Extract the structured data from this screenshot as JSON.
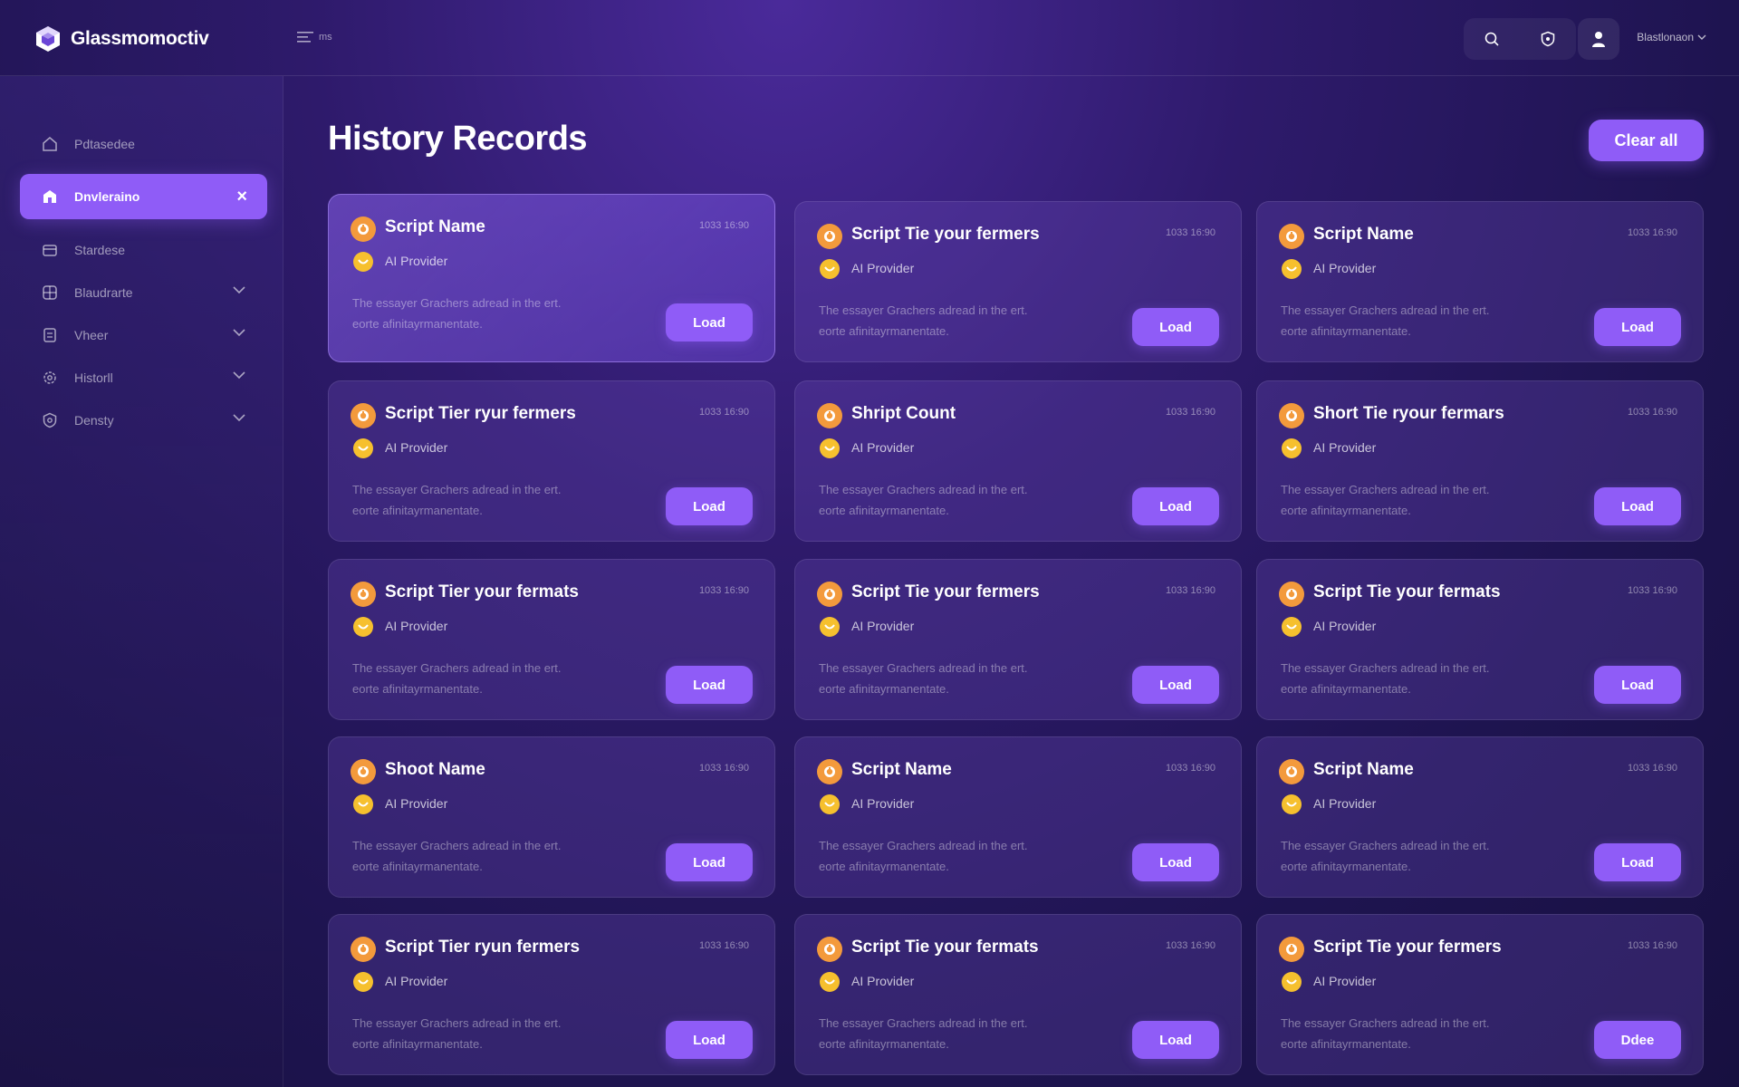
{
  "app": {
    "brand": "Glassmomoctiv"
  },
  "header": {
    "menu_label": "ms",
    "user_name": "Blastlonaon"
  },
  "sidebar": {
    "items": [
      {
        "label": "Pdtasedee",
        "icon": "home-icon",
        "active": false
      },
      {
        "label": "Dnvleraino",
        "icon": "building-icon",
        "active": true
      },
      {
        "label": "Stardese",
        "icon": "folder-icon",
        "active": false
      },
      {
        "label": "Blaudrarte",
        "icon": "grid-icon",
        "active": false
      },
      {
        "label": "Vheer",
        "icon": "document-icon",
        "active": false
      },
      {
        "label": "Historll",
        "icon": "gear-icon",
        "active": false
      },
      {
        "label": "Densty",
        "icon": "shield-gear-icon",
        "active": false
      }
    ]
  },
  "main": {
    "title": "History Records",
    "clear_label": "Clear all",
    "cards": [
      {
        "title": "Script Name",
        "time": "1033 16:90",
        "provider": "AI Provider",
        "desc_line1": "The essayer Grachers adread in the ert.",
        "desc_line2": "eorte afinitayrmanentate.",
        "button": "Load"
      },
      {
        "title": "Script Tie your fermers",
        "time": "1033 16:90",
        "provider": "AI Provider",
        "desc_line1": "The essayer Grachers adread in the ert.",
        "desc_line2": "eorte afinitayrmanentate.",
        "button": "Load"
      },
      {
        "title": "Script Name",
        "time": "1033 16:90",
        "provider": "AI Provider",
        "desc_line1": "The essayer Grachers adread in the ert.",
        "desc_line2": "eorte afinitayrmanentate.",
        "button": "Load"
      },
      {
        "title": "Script Tier ryur fermers",
        "time": "1033 16:90",
        "provider": "AI Provider",
        "desc_line1": "The essayer Grachers adread in the ert.",
        "desc_line2": "eorte afinitayrmanentate.",
        "button": "Load"
      },
      {
        "title": "Shript Count",
        "time": "1033 16:90",
        "provider": "AI Provider",
        "desc_line1": "The essayer Grachers adread in the ert.",
        "desc_line2": "eorte afinitayrmanentate.",
        "button": "Load"
      },
      {
        "title": "Short Tie ryour fermars",
        "time": "1033 16:90",
        "provider": "AI Provider",
        "desc_line1": "The essayer Grachers adread in the ert.",
        "desc_line2": "eorte afinitayrmanentate.",
        "button": "Load"
      },
      {
        "title": "Script Tier your fermats",
        "time": "1033 16:90",
        "provider": "AI Provider",
        "desc_line1": "The essayer Grachers adread in the ert.",
        "desc_line2": "eorte afinitayrmanentate.",
        "button": "Load"
      },
      {
        "title": "Script Tie your fermers",
        "time": "1033 16:90",
        "provider": "AI Provider",
        "desc_line1": "The essayer Grachers adread in the ert.",
        "desc_line2": "eorte afinitayrmanentate.",
        "button": "Load"
      },
      {
        "title": "Script Tie your fermats",
        "time": "1033 16:90",
        "provider": "AI Provider",
        "desc_line1": "The essayer Grachers adread in the ert.",
        "desc_line2": "eorte afinitayrmanentate.",
        "button": "Load"
      },
      {
        "title": "Shoot Name",
        "time": "1033 16:90",
        "provider": "AI Provider",
        "desc_line1": "The essayer Grachers adread in the ert.",
        "desc_line2": "eorte afinitayrmanentate.",
        "button": "Load"
      },
      {
        "title": "Script Name",
        "time": "1033 16:90",
        "provider": "AI Provider",
        "desc_line1": "The essayer Grachers adread in the ert.",
        "desc_line2": "eorte afinitayrmanentate.",
        "button": "Load"
      },
      {
        "title": "Script Name",
        "time": "1033 16:90",
        "provider": "AI Provider",
        "desc_line1": "The essayer Grachers adread in the ert.",
        "desc_line2": "eorte afinitayrmanentate.",
        "button": "Load"
      },
      {
        "title": "Script Tier ryun fermers",
        "time": "1033 16:90",
        "provider": "AI Provider",
        "desc_line1": "The essayer Grachers adread in the ert.",
        "desc_line2": "eorte afinitayrmanentate.",
        "button": "Load"
      },
      {
        "title": "Script Tie your fermats",
        "time": "1033 16:90",
        "provider": "AI Provider",
        "desc_line1": "The essayer Grachers adread in the ert.",
        "desc_line2": "eorte afinitayrmanentate.",
        "button": "Load"
      },
      {
        "title": "Script Tie your fermers",
        "time": "1033 16:90",
        "provider": "AI Provider",
        "desc_line1": "The essayer Grachers adread in the ert.",
        "desc_line2": "eorte afinitayrmanentate.",
        "button": "Ddee"
      }
    ]
  },
  "colors": {
    "accent": "#8f5cf7",
    "script_icon": "#f39a3c",
    "provider_icon": "#f6c02e",
    "background": "#2e1a6b"
  }
}
